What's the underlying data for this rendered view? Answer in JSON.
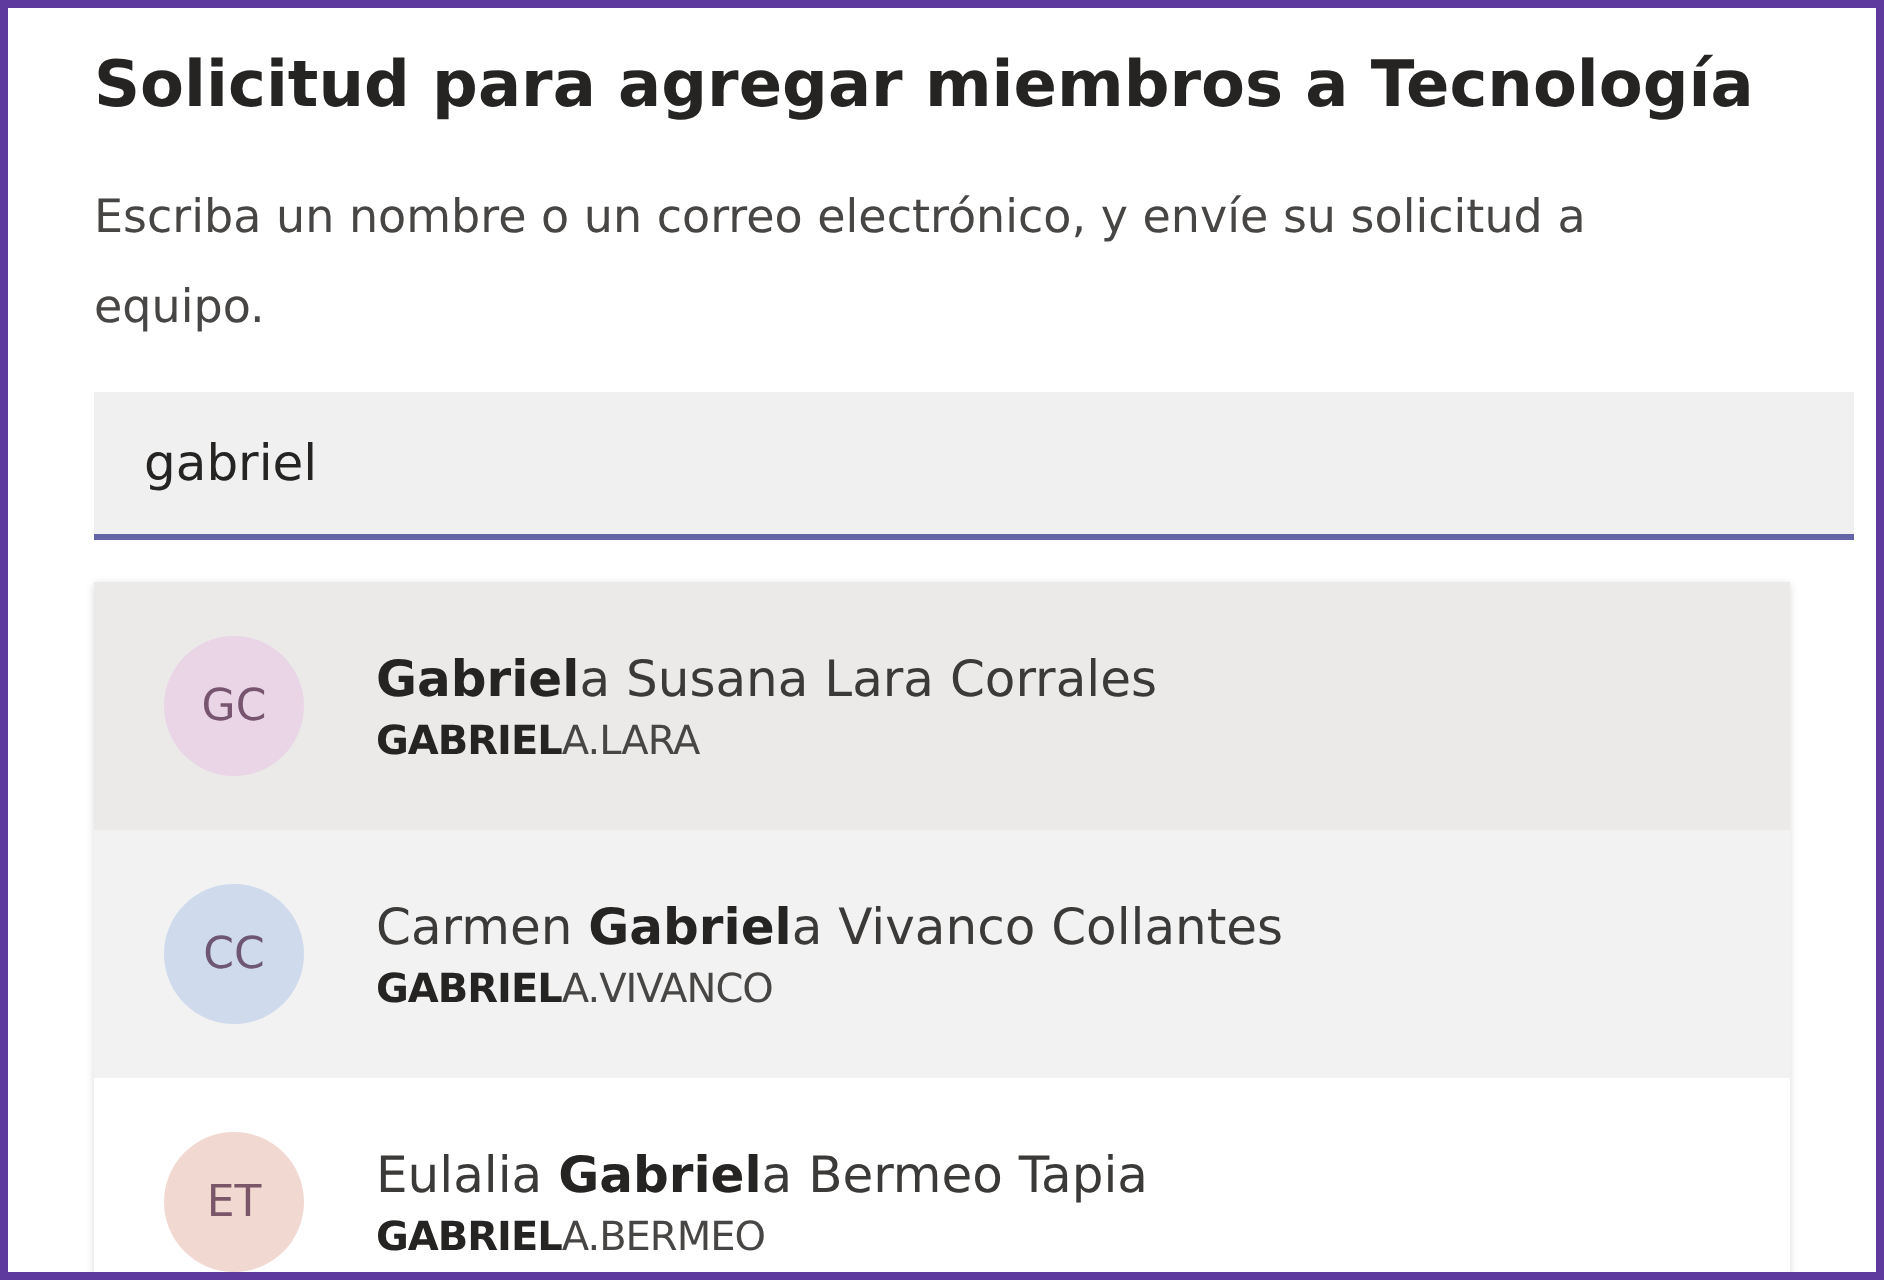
{
  "dialog": {
    "title": "Solicitud para agregar miembros a Tecnología",
    "description_lines": [
      "Escriba un nombre o un correo electrónico, y envíe su solicitud a",
      "equipo."
    ]
  },
  "search": {
    "value": "gabriel",
    "focused": true
  },
  "suggestions": [
    {
      "initials": "GC",
      "color": "#e9d5e6",
      "name": "**Gabriel**a Susana Lara Corrales",
      "username": "**GABRIEL**A.LARA",
      "selected": true,
      "hovered": false
    },
    {
      "initials": "CC",
      "color": "#cfdaec",
      "name": "Carmen **Gabriel**a Vivanco Collantes",
      "username": "**GABRIEL**A.VIVANCO",
      "selected": false,
      "hovered": true
    },
    {
      "initials": "ET",
      "color": "#f1d9d1",
      "name": "Eulalia **Gabriel**a Bermeo Tapia",
      "username": "**GABRIEL**A.BERMEO",
      "selected": false,
      "hovered": false
    }
  ]
}
